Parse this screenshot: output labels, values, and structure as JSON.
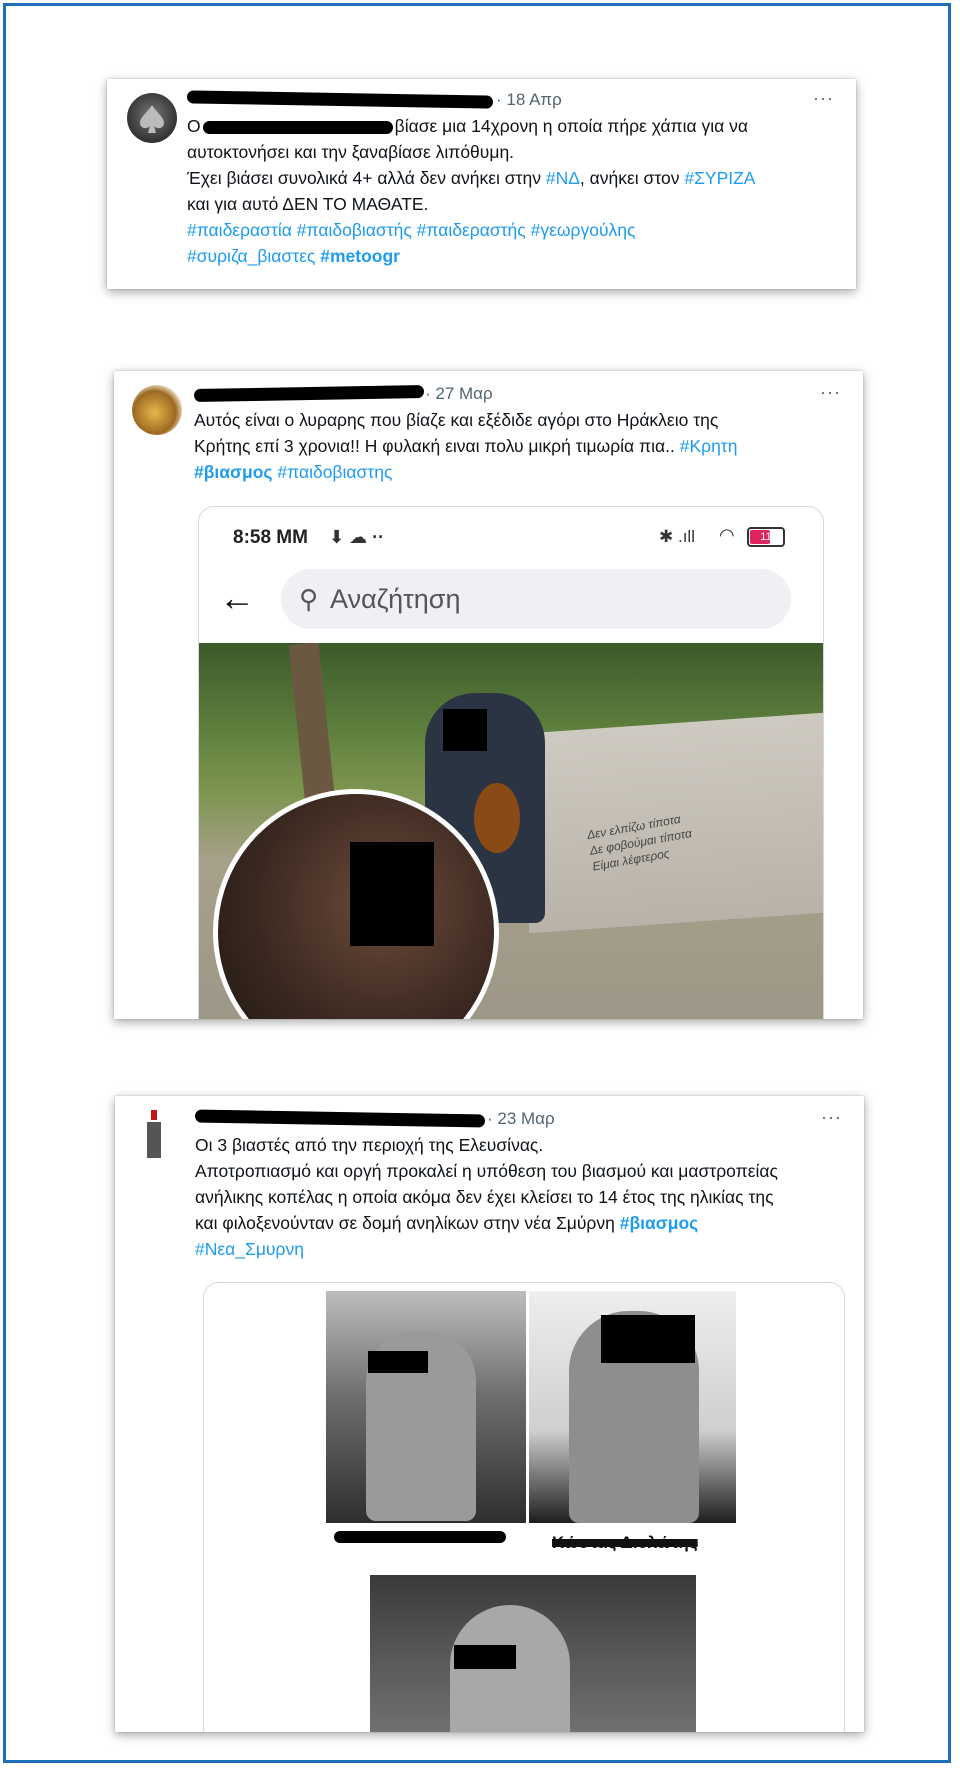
{
  "tweets": [
    {
      "date": "· 18 Απρ",
      "more": "···",
      "text_head": "Ο",
      "text_line1_tail": "βίασε μια 14χρονη η οποία πήρε χάπια για να",
      "text_line2": "αυτοκτονήσει και την ξαναβίασε λιπόθυμη.",
      "text_line3_a": "Έχει βιάσει συνολικά 4+ αλλά δεν ανήκει στην",
      "tag_nd": "#ΝΔ",
      "text_line3_b": ", ανήκει στον",
      "tag_syriza": "#ΣΥΡΙΖΑ",
      "text_line4": "και για αυτό ΔΕΝ ΤΟ ΜΑΘΑΤΕ.",
      "tags_line5": [
        "#παιδεραστία",
        "#παιδοβιαστής",
        "#παιδεραστής",
        "#γεωργούλης"
      ],
      "tag_line6": "#συριζα_βιαστες",
      "tag_line6_bold": "#metoogr"
    },
    {
      "date": "· 27 Μαρ",
      "more": "···",
      "text_line1": "Αυτός είναι ο λυραρης που βίαζε και εξέδιδε αγόρι στο  Ηράκλειο της",
      "text_line2a": "Κρήτης επί 3 χρονια!! Η φυλακή ειναι πολυ μικρή τιμωρία πια..",
      "tag_kriti": "#Κρητη",
      "tag_bold": "#βιασμος",
      "tag_child": "#παιδοβιαστης",
      "phone_time": "8:58 ΜΜ",
      "phone_icons": "⬇ ☁ ··",
      "phone_right": "✱ .ıll",
      "battery": "11",
      "search_placeholder": "Αναζήτηση",
      "graffiti": "Δεν ελπίζω τίποτα\nΔε φοβούμαι τίποτα\nΕίμαι λέφτερος"
    },
    {
      "date": "· 23 Μαρ",
      "more": "···",
      "text_line1": "Οι 3 βιαστές από την περιοχή της Ελευσίνας.",
      "text_line2": "Αποτροπιασμό και οργή προκαλεί η υπόθεση του βιασμού και μαστροπείας",
      "text_line3": "ανήλικης κοπέλας η οποία ακόμα δεν έχει κλείσει το 14 έτος της ηλικίας της",
      "text_line4a": "και φιλοξενούνταν σε δομή ανηλίκων στην νέα Σμύρνη",
      "tag_bold": "#βιασμος",
      "tag_line5": "#Νεα_Σμυρνη",
      "caption_right": "Κώστας Διολώτης"
    }
  ]
}
